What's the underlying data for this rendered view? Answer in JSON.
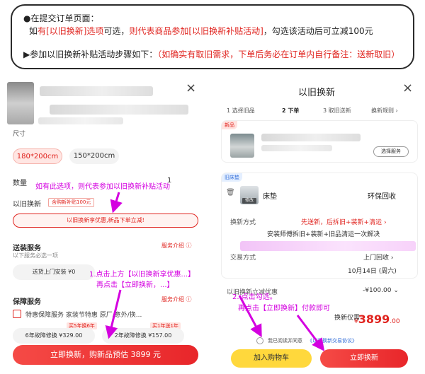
{
  "callout": {
    "line1": "●在提交订单页面：",
    "line2_a": "如",
    "line2_b": "有[以旧换新]选项",
    "line2_c": "可选，",
    "line2_d": "则代表商品参加[以旧换新补贴活动]",
    "line2_e": "，勾选该活动后可立减100元",
    "line3_a": "▶参加以旧换新补贴活动步骤如下：",
    "line3_b": "（如确实有取旧需求，下单后务必在订单内自行备注：送新取旧）"
  },
  "left": {
    "close": "×",
    "size_label": "尺寸",
    "size_options": [
      "180*200cm",
      "150*200cm"
    ],
    "qty_label": "数量",
    "qty_value": "1",
    "tradein_label": "以旧换新",
    "tradein_badge": "含购新补贴100元",
    "tradein_banner": "以旧换新享优惠,新品下单立减!",
    "delivery_title": "送装服务",
    "delivery_intro": "服务介绍 ⓘ",
    "delivery_note": "以下服务必选一项",
    "delivery_chip": "送货上门安装 ¥0",
    "warranty_title": "保障服务",
    "warranty_intro": "服务介绍 ⓘ",
    "warranty_row": "特惠保障服务  家装节特惠  原厂/意外/换...",
    "warranty_opt1_tag": "买5年换6年",
    "warranty_opt1": "6年故障修换  ¥329.00",
    "warranty_opt2_tag": "买1年送1年",
    "warranty_opt2": "2年故障修换  ¥157.00",
    "submit": "立即换新，购新品预估 3899 元"
  },
  "right": {
    "title": "以旧换新",
    "close": "×",
    "steps": [
      "1 选择旧品",
      "2 下单",
      "3 取旧送新"
    ],
    "rules": "换新规则 ›",
    "new_tag": "新品",
    "choose_service": "选择服务",
    "old_tag": "旧床垫",
    "old_item": "床垫",
    "old_thumb": "修改",
    "recycle": "环保回收",
    "method_label": "换新方式",
    "method_value": "先送新，后拆旧+装新+清运 ›",
    "method_desc": "安装师傅拆旧+装新+旧品清运一次解决",
    "trade_label": "交易方式",
    "trade_value": "上门回收 ›",
    "trade_date": "10月14日 (周六)",
    "discount_label": "以旧换新立减优惠",
    "discount_value": "-¥100.00 ⌄",
    "price_label": "换新仅需",
    "price_symbol": "¥",
    "price_value": "3899",
    "price_decimal": ".00",
    "agree": "我已阅读并同意",
    "agree_link": "《以旧换新交易协议》",
    "cart": "加入购物车",
    "submit": "立即换新"
  },
  "annotations": {
    "left_top": "如有此选项，则代表参加以旧换新补贴活动",
    "left_mid1": "1.点击上方【以旧换新享优惠...】",
    "left_mid2": "再点击【立即换新，...】",
    "right_1": "2. 点击勾选。",
    "right_2": "再点击【立即换新】付款即可"
  },
  "colors": {
    "red": "#e0241f",
    "magenta": "#d400e0",
    "cart": "#ffd83c"
  }
}
